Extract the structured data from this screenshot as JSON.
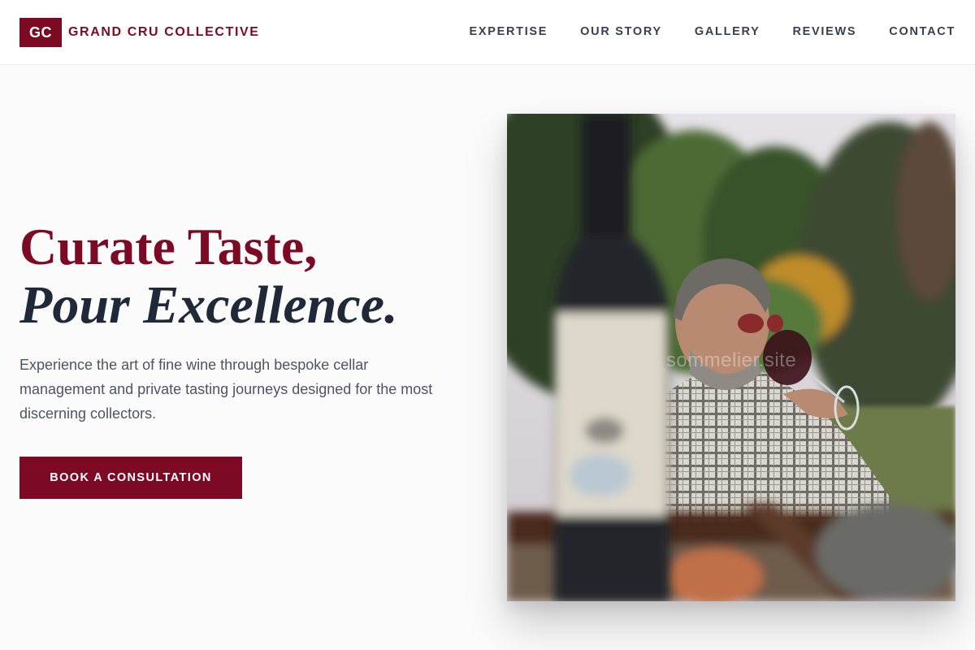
{
  "brand": {
    "mark": "GC",
    "name": "GRAND CRU COLLECTIVE",
    "color": "#7d0a25"
  },
  "nav": {
    "items": [
      {
        "label": "EXPERTISE"
      },
      {
        "label": "OUR STORY"
      },
      {
        "label": "GALLERY"
      },
      {
        "label": "REVIEWS"
      },
      {
        "label": "CONTACT"
      }
    ]
  },
  "hero": {
    "headline_line1": "Curate Taste,",
    "headline_line2": "Pour Excellence.",
    "lead": "Experience the art of fine wine through bespoke cellar management and private tasting journeys designed for the most discerning collectors.",
    "cta_label": "BOOK A CONSULTATION",
    "image_watermark": "sommelier.site"
  }
}
